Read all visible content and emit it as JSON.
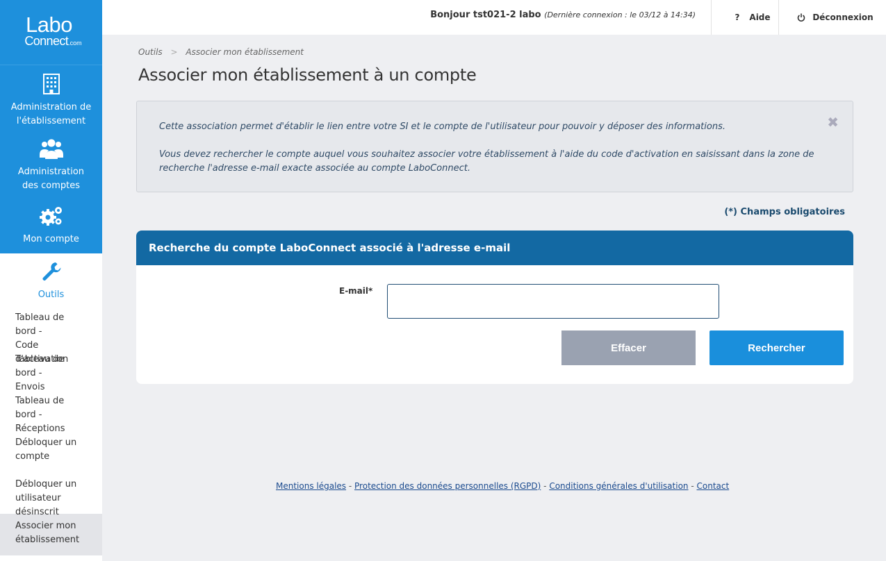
{
  "brand": {
    "line1": "Labo",
    "line2": "Connect",
    "suffix": ".com"
  },
  "colors": {
    "primary": "#1e90dc",
    "header": "#1369a3",
    "clear_button": "#9aa2b1"
  },
  "sidebar": {
    "admin_etablissement": {
      "line1": "Administration de",
      "line2": "l'établissement",
      "icon": "building-icon"
    },
    "admin_comptes": {
      "line1": "Administration",
      "line2": "des comptes",
      "icon": "users-icon"
    },
    "mon_compte": {
      "label": "Mon compte",
      "icon": "gears-icon"
    },
    "outils": {
      "label": "Outils",
      "icon": "wrench-icon"
    },
    "items": [
      {
        "line1": "Tableau de bord -",
        "line2": "Code d'activation"
      },
      {
        "line1": "Tableau de bord -",
        "line2": "Envois"
      },
      {
        "line1": "Tableau de bord -",
        "line2": "Réceptions"
      },
      {
        "line1": "Débloquer un",
        "line2": "compte"
      },
      {
        "line1": "Débloquer un",
        "line2": "utilisateur désinscrit"
      },
      {
        "line1": "Associer mon",
        "line2": "établissement"
      }
    ]
  },
  "topbar": {
    "greeting": "Bonjour tst021-2 labo",
    "last_login": "(Dernière connexion : le 03/12 à 14:34)",
    "help": "Aide",
    "help_symbol": "?",
    "logout": "Déconnexion"
  },
  "breadcrumb": {
    "root": "Outils",
    "separator": ">",
    "current": "Associer mon établissement"
  },
  "page_title": "Associer mon établissement à un compte",
  "info": {
    "paragraph1": "Cette association permet d'établir le lien entre votre SI et le compte de l'utilisateur pour pouvoir y déposer des informations.",
    "paragraph2": "Vous devez rechercher le compte auquel vous souhaitez associer votre établissement à l'aide du code d'activation en saisissant dans la zone de recherche l'adresse e-mail exacte associée au compte LaboConnect.",
    "close": "✖"
  },
  "required_note": "(*) Champs obligatoires",
  "form": {
    "title": "Recherche du compte LaboConnect associé à l'adresse e-mail",
    "email_label": "E-mail*",
    "email_value": "",
    "clear_label": "Effacer",
    "search_label": "Rechercher"
  },
  "footer": {
    "links": [
      "Mentions légales",
      "Protection des données personnelles (RGPD)",
      "Conditions générales d'utilisation",
      "Contact"
    ],
    "separator": " - "
  }
}
